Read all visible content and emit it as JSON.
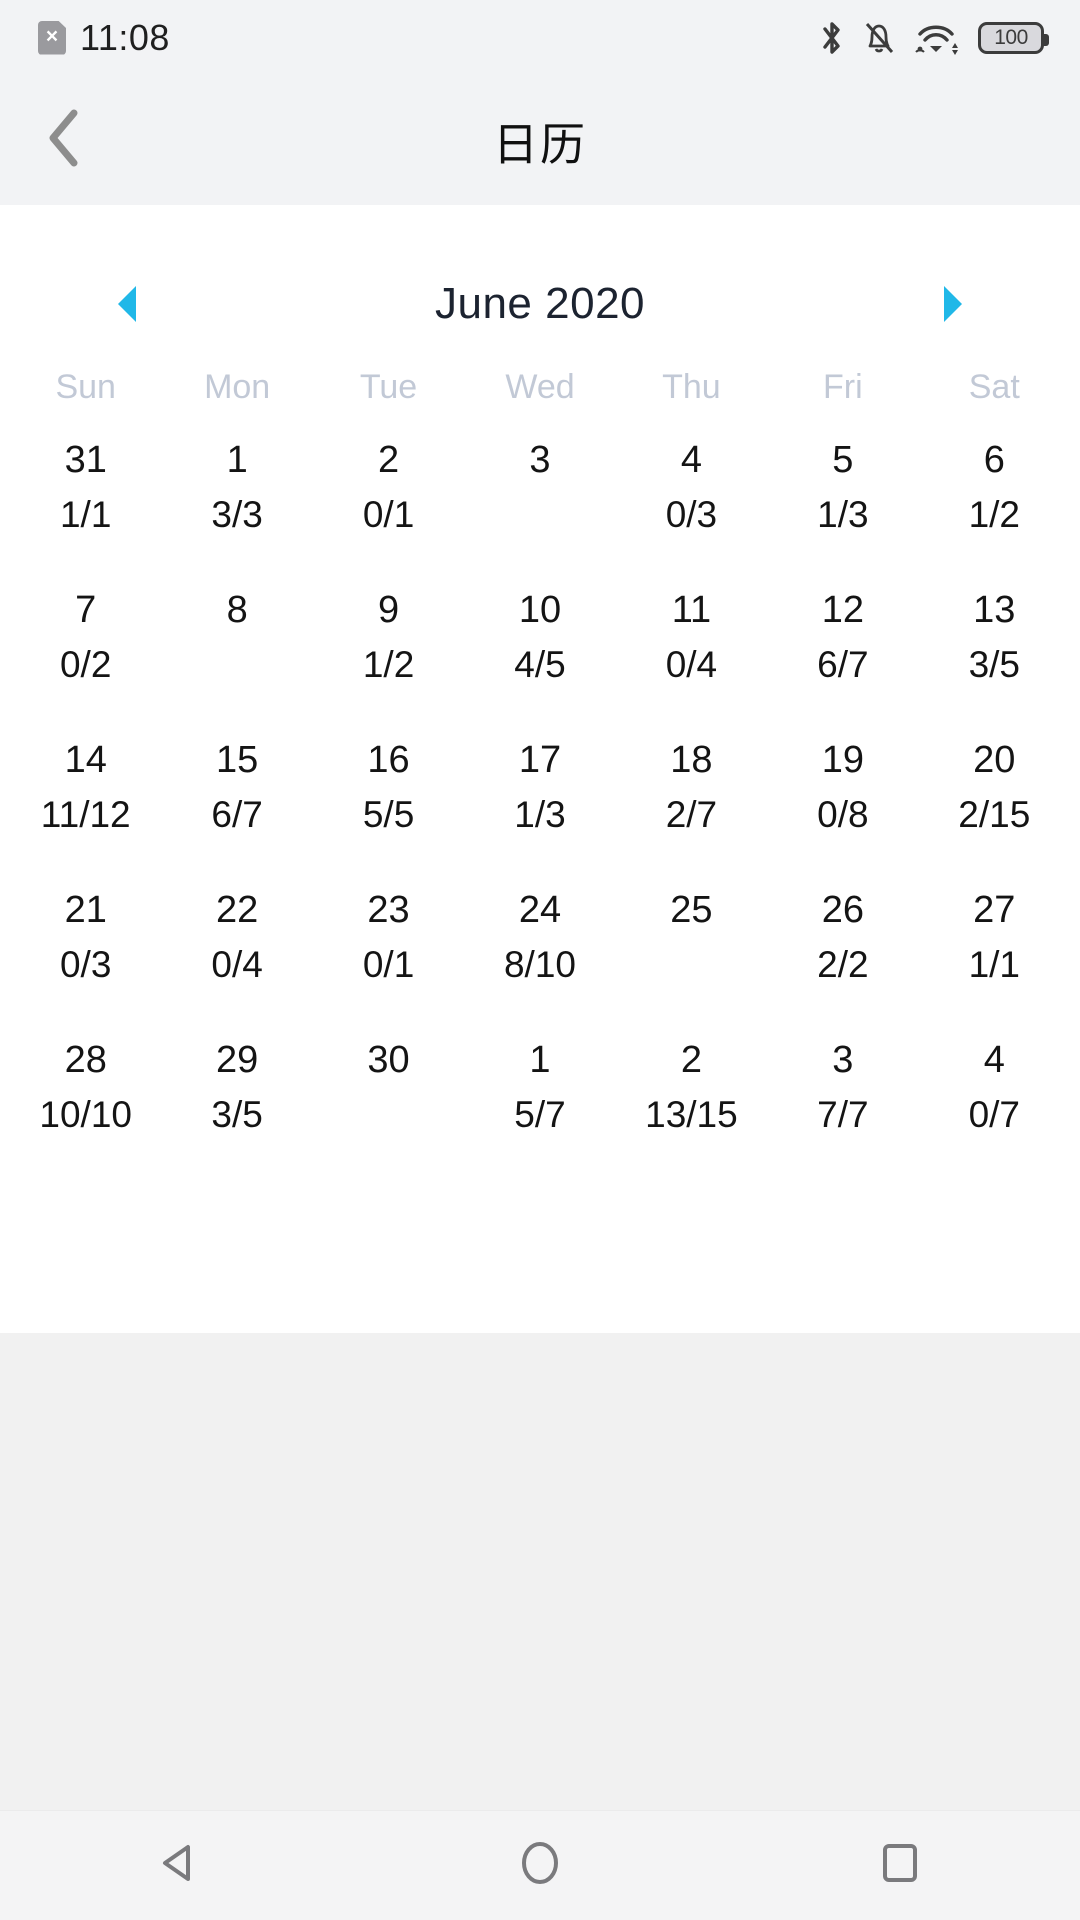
{
  "status_bar": {
    "sim_icon": "sim-card-no-service-icon",
    "sim_glyph": "×",
    "time": "11:08",
    "icons": [
      "bluetooth-icon",
      "notifications-off-icon",
      "wifi-icon"
    ],
    "battery_level": "100"
  },
  "header": {
    "back_icon": "chevron-left-icon",
    "title": "日历"
  },
  "calendar": {
    "prev_icon": "triangle-left-icon",
    "next_icon": "triangle-right-icon",
    "month_label": "June 2020",
    "weekdays": [
      "Sun",
      "Mon",
      "Tue",
      "Wed",
      "Thu",
      "Fri",
      "Sat"
    ],
    "weeks": [
      [
        {
          "day": "31",
          "count": "1/1"
        },
        {
          "day": "1",
          "count": "3/3"
        },
        {
          "day": "2",
          "count": "0/1"
        },
        {
          "day": "3",
          "count": ""
        },
        {
          "day": "4",
          "count": "0/3"
        },
        {
          "day": "5",
          "count": "1/3"
        },
        {
          "day": "6",
          "count": "1/2"
        }
      ],
      [
        {
          "day": "7",
          "count": "0/2"
        },
        {
          "day": "8",
          "count": ""
        },
        {
          "day": "9",
          "count": "1/2"
        },
        {
          "day": "10",
          "count": "4/5"
        },
        {
          "day": "11",
          "count": "0/4"
        },
        {
          "day": "12",
          "count": "6/7"
        },
        {
          "day": "13",
          "count": "3/5"
        }
      ],
      [
        {
          "day": "14",
          "count": "11/12"
        },
        {
          "day": "15",
          "count": "6/7"
        },
        {
          "day": "16",
          "count": "5/5"
        },
        {
          "day": "17",
          "count": "1/3"
        },
        {
          "day": "18",
          "count": "2/7"
        },
        {
          "day": "19",
          "count": "0/8"
        },
        {
          "day": "20",
          "count": "2/15"
        }
      ],
      [
        {
          "day": "21",
          "count": "0/3"
        },
        {
          "day": "22",
          "count": "0/4"
        },
        {
          "day": "23",
          "count": "0/1"
        },
        {
          "day": "24",
          "count": "8/10"
        },
        {
          "day": "25",
          "count": ""
        },
        {
          "day": "26",
          "count": "2/2"
        },
        {
          "day": "27",
          "count": "1/1"
        }
      ],
      [
        {
          "day": "28",
          "count": "10/10"
        },
        {
          "day": "29",
          "count": "3/5"
        },
        {
          "day": "30",
          "count": ""
        },
        {
          "day": "1",
          "count": "5/7"
        },
        {
          "day": "2",
          "count": "13/15"
        },
        {
          "day": "3",
          "count": "7/7"
        },
        {
          "day": "4",
          "count": "0/7"
        }
      ]
    ]
  },
  "nav_bar": {
    "back_icon": "triangle-back-icon",
    "home_icon": "circle-home-icon",
    "recents_icon": "square-recents-icon"
  },
  "colors": {
    "accent": "#20b8e8",
    "status_bg": "#f2f3f5",
    "card_bg": "#ffffff",
    "page_bg": "#f1f1f1",
    "weekday_text": "#c2c9d6",
    "day_text": "#141414"
  }
}
